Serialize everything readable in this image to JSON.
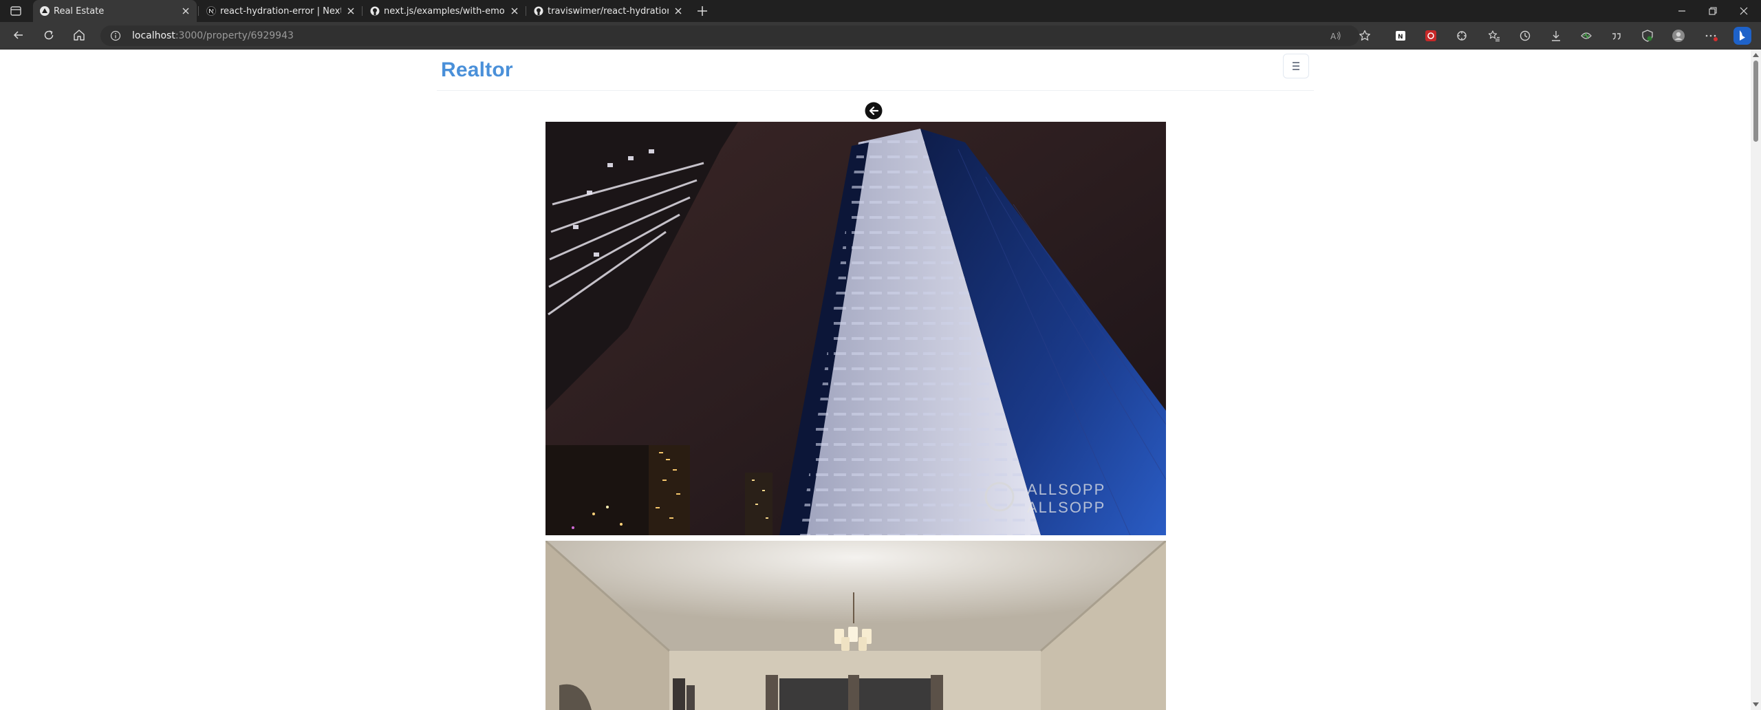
{
  "browser": {
    "tabs": [
      {
        "title": "Real Estate",
        "favicon": "nextjs-triangle-icon",
        "active": true
      },
      {
        "title": "react-hydration-error | Next.js",
        "favicon": "nextjs-icon",
        "active": false
      },
      {
        "title": "next.js/examples/with-emotion a",
        "favicon": "github-icon",
        "active": false
      },
      {
        "title": "traviswimer/react-hydration-pro",
        "favicon": "github-icon",
        "active": false
      }
    ],
    "address": {
      "host": "localhost",
      "rest": ":3000/property/6929943"
    },
    "toolbar_icons": [
      "read-aloud-icon",
      "favorite-star-icon",
      "extension-icon",
      "extension-icon",
      "extensions-puzzle-icon",
      "favorites-icon",
      "history-icon",
      "downloads-icon",
      "performance-icon",
      "quote-icon",
      "browser-essentials-icon",
      "profile-avatar-icon",
      "more-menu-icon",
      "bing-copilot-icon"
    ]
  },
  "page": {
    "brand": "Realtor",
    "brand_color": "#4a90d9",
    "photos": [
      {
        "alt": "Night view looking up at a high-rise tower",
        "watermark_line1": "ALLSOPP",
        "watermark_line2": "ALLSOPP"
      },
      {
        "alt": "Interior room with chandelier"
      }
    ]
  }
}
